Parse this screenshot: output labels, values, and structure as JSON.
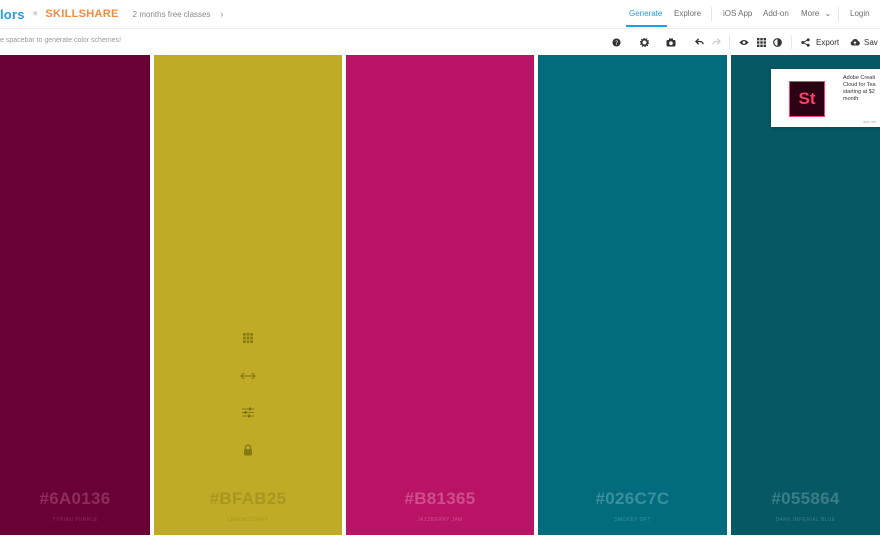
{
  "header": {
    "logo": "lors",
    "promo_star": "✶",
    "promo_brand": "SKILLSHARE",
    "promo_text": "2 months free classes",
    "promo_chevron": "›",
    "nav": {
      "generate": "Generate",
      "explore": "Explore",
      "ios_app": "iOS App",
      "addon": "Add-on",
      "more": "More",
      "more_chevron": "⌄",
      "login": "Login"
    }
  },
  "toolbar": {
    "hint": "e spacebar to generate color schemes!",
    "icons": {
      "help": "help-icon",
      "settings": "gear-icon",
      "camera": "camera-icon",
      "undo": "undo-icon",
      "redo": "redo-icon",
      "eye": "eye-icon",
      "grid": "grid-icon",
      "contrast": "contrast-icon",
      "share": "share-icon",
      "save": "cloud-save-icon"
    },
    "export_label": "Export",
    "save_label": "Sav"
  },
  "palette": [
    {
      "hex": "#6A0136",
      "name": "TYRIAN PURPLE",
      "color": "#6A0136",
      "text_color": "#8d2d5a"
    },
    {
      "hex": "#BFAB25",
      "name": "LEMON CURRY",
      "color": "#BFAB25",
      "text_color": "#a99620"
    },
    {
      "hex": "#B81365",
      "name": "JAZZBERRY JAM",
      "color": "#B81365",
      "text_color": "#cf4d8c"
    },
    {
      "hex": "#026C7C",
      "name": "SMOKEY OFT",
      "color": "#026C7C",
      "text_color": "#3a8f9c"
    },
    {
      "hex": "#055864",
      "name": "DARK IMPERIAL BLUE",
      "color": "#055864",
      "text_color": "#3a7d87"
    }
  ],
  "swatch_tools": {
    "drag": "drag-grid-icon",
    "resize": "swap-arrows-icon",
    "adjust": "sliders-icon",
    "lock": "lock-icon"
  },
  "ad": {
    "logo_text": "St",
    "text": "Adobe Creati Cloud for Tea starting at $2 month",
    "via": "ads via"
  }
}
